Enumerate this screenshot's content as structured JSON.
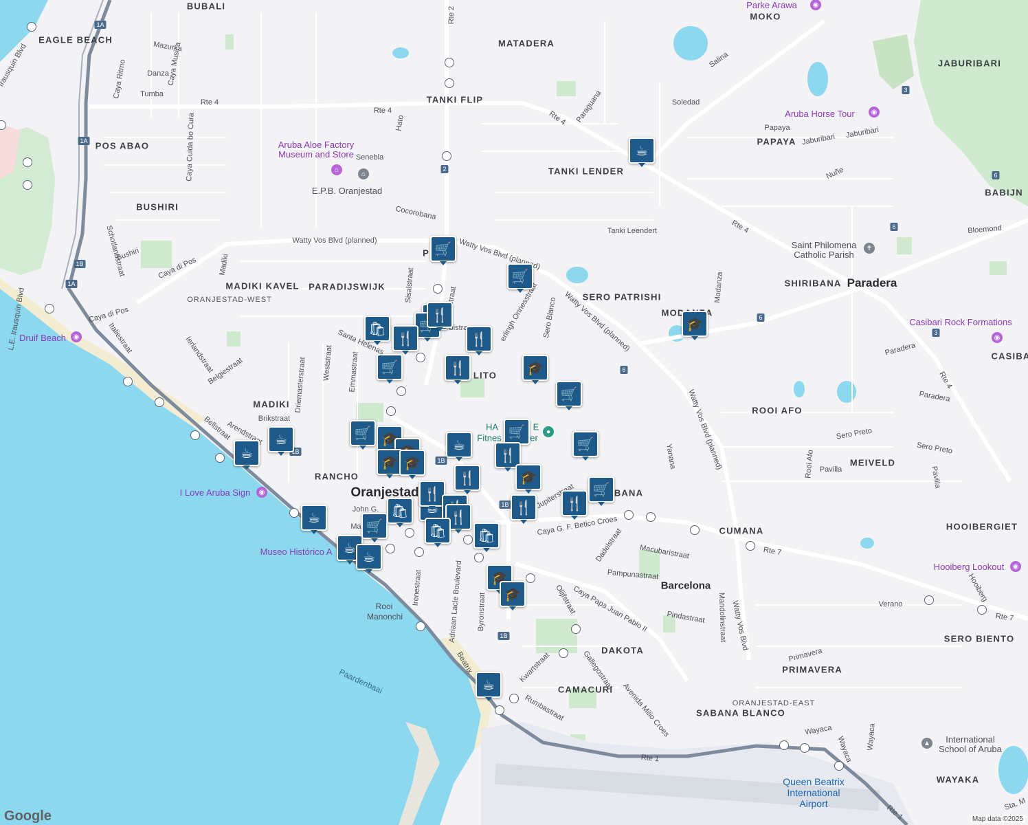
{
  "areas": [
    {
      "id": "bubali",
      "text": "BUBALI"
    },
    {
      "id": "eagle-beach",
      "text": "EAGLE BEACH"
    },
    {
      "id": "matadera",
      "text": "MATADERA"
    },
    {
      "id": "moko",
      "text": "MOKO"
    },
    {
      "id": "jaburibari",
      "text": "JABURIBARI"
    },
    {
      "id": "tanki-flip",
      "text": "TANKI FLIP"
    },
    {
      "id": "pos-abao",
      "text": "POS ABAO"
    },
    {
      "id": "papaya",
      "text": "PAPAYA"
    },
    {
      "id": "tanki-lender",
      "text": "TANKI LENDER"
    },
    {
      "id": "babijn",
      "text": "BABIJN"
    },
    {
      "id": "bushiri",
      "text": "BUSHIRI"
    },
    {
      "id": "madiki-kavel",
      "text": "MADIKI KAVEL"
    },
    {
      "id": "paradijswijk",
      "text": "PARADIJSWIJK"
    },
    {
      "id": "oranjestad-west",
      "text": "ORANJESTAD-WEST"
    },
    {
      "id": "sero-patrishi",
      "text": "SERO PATRISHI"
    },
    {
      "id": "shiribana",
      "text": "SHIRIBANA"
    },
    {
      "id": "casibari",
      "text": "CASIBA"
    },
    {
      "id": "madiki",
      "text": "MADIKI"
    },
    {
      "id": "rooi-afo",
      "text": "ROOI AFO"
    },
    {
      "id": "meiveld",
      "text": "MEIVELD"
    },
    {
      "id": "rancho",
      "text": "RANCHO"
    },
    {
      "id": "bana",
      "text": "BANA"
    },
    {
      "id": "cumana",
      "text": "CUMANA"
    },
    {
      "id": "hooibergiet",
      "text": "HOOIBERGIET"
    },
    {
      "id": "dakota",
      "text": "DAKOTA"
    },
    {
      "id": "sero-biento",
      "text": "SERO BIENTO"
    },
    {
      "id": "primavera",
      "text": "PRIMAVERA"
    },
    {
      "id": "camacuri",
      "text": "CAMACURI"
    },
    {
      "id": "sabana-blanco",
      "text": "SABANA BLANCO"
    },
    {
      "id": "oranjestad-east",
      "text": "ORANJESTAD-EAST"
    },
    {
      "id": "wayaka",
      "text": "WAYAKA"
    },
    {
      "id": "modanza",
      "text": "MODANZA"
    },
    {
      "id": "lito",
      "text": "LITO"
    },
    {
      "id": "pos-chiquito",
      "text": "P"
    }
  ],
  "towns": [
    {
      "id": "oranjestad",
      "text": "Oranjestad"
    },
    {
      "id": "paradera",
      "text": "Paradera"
    },
    {
      "id": "barcelona",
      "text": "Barcelona"
    }
  ],
  "roads": [
    {
      "id": "rte4-a",
      "text": "Rte 4"
    },
    {
      "id": "rte4-b",
      "text": "Rte 4"
    },
    {
      "id": "rte4-c",
      "text": "Rte 4"
    },
    {
      "id": "rte4-d",
      "text": "Rte 4"
    },
    {
      "id": "rte4-e",
      "text": "Rte 4"
    },
    {
      "id": "rte7-a",
      "text": "Rte 7"
    },
    {
      "id": "rte7-b",
      "text": "Rte 7"
    },
    {
      "id": "rte1-a",
      "text": "Rte 1"
    },
    {
      "id": "rte1-b",
      "text": "Rte 1"
    },
    {
      "id": "rte2",
      "text": "Rte 2"
    },
    {
      "id": "watty-1",
      "text": "Watty Vos Blvd (planned)"
    },
    {
      "id": "watty-2",
      "text": "Watty Vos Blvd (planned)"
    },
    {
      "id": "watty-3",
      "text": "Watty Vos Blvd (planned)"
    },
    {
      "id": "watty-4",
      "text": "Watty Vos Blvd (planned)"
    },
    {
      "id": "watty-5",
      "text": "Watty Vos Blvd"
    },
    {
      "id": "caya-di-pos",
      "text": "Caya di Pos"
    },
    {
      "id": "caya-di-pos-2",
      "text": "Caya di Pos"
    },
    {
      "id": "schotlandstraat",
      "text": "Schotlandstraat"
    },
    {
      "id": "italiestraat",
      "text": "Italiestraat"
    },
    {
      "id": "ierlandstraat",
      "text": "Ierlandstraat"
    },
    {
      "id": "belgiestraat",
      "text": "Belgiestraat"
    },
    {
      "id": "arendstraat",
      "text": "Arendstraat"
    },
    {
      "id": "bellstraat",
      "text": "Bellstraat"
    },
    {
      "id": "brikstraat",
      "text": "Brikstraat"
    },
    {
      "id": "driemasterstraat",
      "text": "Driemasterstraat"
    },
    {
      "id": "weststraat",
      "text": "Weststraat"
    },
    {
      "id": "emmastraat",
      "text": "Emmastraat"
    },
    {
      "id": "santa-helenastraat",
      "text": "Santa Helenas"
    },
    {
      "id": "sisalstraat",
      "text": "Sisalstraat"
    },
    {
      "id": "mazurka",
      "text": "Mazurka"
    },
    {
      "id": "danza",
      "text": "Danza"
    },
    {
      "id": "tumba",
      "text": "Tumba"
    },
    {
      "id": "caya-ritmo",
      "text": "Caya Ritmo"
    },
    {
      "id": "caya-musica",
      "text": "Caya Musica"
    },
    {
      "id": "caya-cuida",
      "text": "Caya Cuida bo Cura"
    },
    {
      "id": "hato",
      "text": "Hato"
    },
    {
      "id": "senebla",
      "text": "Senebla"
    },
    {
      "id": "cocorobana",
      "text": "Cocorobana"
    },
    {
      "id": "paraguana",
      "text": "Paraguana"
    },
    {
      "id": "soledad",
      "text": "Soledad"
    },
    {
      "id": "salina",
      "text": "Salina"
    },
    {
      "id": "papaya-st",
      "text": "Papaya"
    },
    {
      "id": "jaburibari-1",
      "text": "Jaburibari"
    },
    {
      "id": "jaburibari-2",
      "text": "Jaburibari"
    },
    {
      "id": "nune",
      "text": "Nuñe"
    },
    {
      "id": "bloemond",
      "text": "Bloemond"
    },
    {
      "id": "tanki-leendert",
      "text": "Tanki Leendert"
    },
    {
      "id": "modanza-st",
      "text": "Modanza"
    },
    {
      "id": "sero-blanco",
      "text": "Sero Blanco"
    },
    {
      "id": "onnesstraat",
      "text": "erlingh Onnesstraat"
    },
    {
      "id": "paradera-st",
      "text": "Paradera"
    },
    {
      "id": "paradera-st2",
      "text": "Paradera"
    },
    {
      "id": "sero-preto-1",
      "text": "Sero Preto"
    },
    {
      "id": "sero-preto-2",
      "text": "Sero Preto"
    },
    {
      "id": "yanana",
      "text": "Yanana"
    },
    {
      "id": "rooi-afo-st",
      "text": "Rooi Afo"
    },
    {
      "id": "pavilla-1",
      "text": "Pavilla"
    },
    {
      "id": "pavilla-2",
      "text": "Pavilla"
    },
    {
      "id": "jupiterstraat",
      "text": "Jupiterstraat"
    },
    {
      "id": "betico",
      "text": "Caya G. F. Betico Croes"
    },
    {
      "id": "dadelstraat",
      "text": "Dadelstraat"
    },
    {
      "id": "macubaristraat",
      "text": "Macubaristraat"
    },
    {
      "id": "pampunastraat",
      "text": "Pampunastraat"
    },
    {
      "id": "pindastraat",
      "text": "Pindastraat"
    },
    {
      "id": "mandolinstraat",
      "text": "Mandolinstraat"
    },
    {
      "id": "papa-juan",
      "text": "Caya Papa Juan Pablo II"
    },
    {
      "id": "olijfstraat",
      "text": "Olijfstraat"
    },
    {
      "id": "gallegostraat",
      "text": "Gallegostraat"
    },
    {
      "id": "avenida-milio",
      "text": "Avenida Milio Croes"
    },
    {
      "id": "kwartstraat",
      "text": "Kwartstraat"
    },
    {
      "id": "rumbastraat",
      "text": "Rumbastraat"
    },
    {
      "id": "byronstraat",
      "text": "Byronstraat"
    },
    {
      "id": "adriaan",
      "text": "Adriaan Lacle Boulevard"
    },
    {
      "id": "irenestraat",
      "text": "Irenestraat"
    },
    {
      "id": "beatrix",
      "text": "Beatrix"
    },
    {
      "id": "hooiberg",
      "text": "Hooiberg"
    },
    {
      "id": "verano",
      "text": "Verano"
    },
    {
      "id": "primavera-st",
      "text": "Primavera"
    },
    {
      "id": "wayaca-1",
      "text": "Wayaca"
    },
    {
      "id": "wayaca-2",
      "text": "Wayaca"
    },
    {
      "id": "wayaca-3",
      "text": "Wayaca"
    },
    {
      "id": "john-g",
      "text": "John G."
    },
    {
      "id": "ma",
      "text": "Ma"
    },
    {
      "id": "le-irausquin",
      "text": "L.E. Irausquin Blvd"
    },
    {
      "id": "irausquin-blvd",
      "text": "Irausquin Blvd"
    },
    {
      "id": "bushiri-st",
      "text": "Bushiri"
    },
    {
      "id": "madiki-st",
      "text": "Madiki"
    },
    {
      "id": "sta-m",
      "text": "Sta. M"
    },
    {
      "id": "opetstraat",
      "text": "opetstraat"
    },
    {
      "id": "bistra",
      "text": "bistra"
    }
  ],
  "pois": [
    {
      "id": "parke-arawa",
      "text": "Parke Arawa"
    },
    {
      "id": "aruba-horse-tour",
      "text": "Aruba Horse Tour"
    },
    {
      "id": "aloe-factory-1",
      "text": "Aruba Aloe Factory"
    },
    {
      "id": "aloe-factory-2",
      "text": "Museum and Store"
    },
    {
      "id": "epb",
      "text": "E.P.B. Oranjestad"
    },
    {
      "id": "saint-philomena-1",
      "text": "Saint Philomena"
    },
    {
      "id": "saint-philomena-2",
      "text": "Catholic Parish"
    },
    {
      "id": "casibari-rock",
      "text": "Casibari Rock Formations"
    },
    {
      "id": "druif-beach",
      "text": "Druif Beach"
    },
    {
      "id": "i-love-aruba",
      "text": "I Love Aruba Sign"
    },
    {
      "id": "museo-historico",
      "text": "Museo Histórico A"
    },
    {
      "id": "hooiberg-lookout",
      "text": "Hooiberg Lookout"
    },
    {
      "id": "int-school-1",
      "text": "International"
    },
    {
      "id": "int-school-2",
      "text": "School of Aruba"
    },
    {
      "id": "ha-fitness-1",
      "text": "HA"
    },
    {
      "id": "ha-fitness-2",
      "text": "Fitnes"
    },
    {
      "id": "ha-fitness-3",
      "text": "E"
    },
    {
      "id": "ha-fitness-4",
      "text": "er"
    },
    {
      "id": "rooi-manonchi-1",
      "text": "Rooi"
    },
    {
      "id": "rooi-manonchi-2",
      "text": "Manonchi"
    }
  ],
  "water_labels": [
    {
      "id": "paardenbaai",
      "text": "Paardenbaai"
    }
  ],
  "airport": {
    "line1": "Queen Beatrix",
    "line2": "International",
    "line3": "Airport"
  },
  "shields": [
    "1A",
    "1A",
    "1A",
    "1B",
    "1B",
    "1B",
    "1B",
    "1B",
    "2",
    "3",
    "3",
    "6",
    "6",
    "6",
    "6"
  ],
  "markers": [
    {
      "type": "cafe"
    },
    {
      "type": "cafe"
    },
    {
      "type": "cafe"
    },
    {
      "type": "cafe"
    },
    {
      "type": "cafe"
    },
    {
      "type": "cafe"
    },
    {
      "type": "cafe"
    },
    {
      "type": "cafe"
    },
    {
      "type": "cafe"
    },
    {
      "type": "grocery"
    },
    {
      "type": "grocery"
    },
    {
      "type": "grocery"
    },
    {
      "type": "grocery"
    },
    {
      "type": "grocery"
    },
    {
      "type": "grocery"
    },
    {
      "type": "grocery"
    },
    {
      "type": "grocery"
    },
    {
      "type": "grocery"
    },
    {
      "type": "grocery"
    },
    {
      "type": "grocery"
    },
    {
      "type": "restaurant"
    },
    {
      "type": "restaurant"
    },
    {
      "type": "restaurant"
    },
    {
      "type": "restaurant"
    },
    {
      "type": "restaurant"
    },
    {
      "type": "restaurant"
    },
    {
      "type": "restaurant"
    },
    {
      "type": "restaurant"
    },
    {
      "type": "restaurant"
    },
    {
      "type": "restaurant"
    },
    {
      "type": "restaurant"
    },
    {
      "type": "school"
    },
    {
      "type": "school"
    },
    {
      "type": "school"
    },
    {
      "type": "school"
    },
    {
      "type": "school"
    },
    {
      "type": "school"
    },
    {
      "type": "school"
    },
    {
      "type": "school"
    },
    {
      "type": "school"
    },
    {
      "type": "shopping"
    },
    {
      "type": "shopping"
    },
    {
      "type": "shopping"
    },
    {
      "type": "shopping"
    }
  ],
  "branding": {
    "logo": "Google",
    "attribution": "Map data ©2025"
  }
}
